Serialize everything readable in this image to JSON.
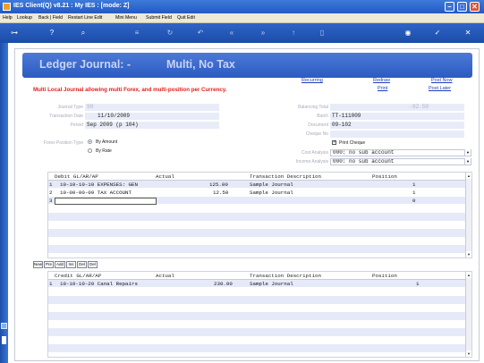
{
  "window": {
    "title": "IES Client(Q) v8.21 : My IES :      [mode: Z]",
    "minimize": "–",
    "maximize": "□",
    "close": "✕"
  },
  "menu": [
    "Help",
    "Lookup",
    "Back | Field",
    "Restart Line Edit",
    "Mini Menu",
    "Submit Field",
    "Quit Edit"
  ],
  "toolbar_icons": [
    "key-icon",
    "help-icon",
    "search-icon",
    "list-icon",
    "recycle-icon",
    "back-icon",
    "rewind-icon",
    "forward-icon",
    "up-icon",
    "save-icon",
    "globe-icon",
    "check-icon",
    "close-icon"
  ],
  "header": {
    "title": "Ledger Journal: -",
    "subtitle": "Multi, No Tax"
  },
  "links": {
    "recurring": "Recurring",
    "redraw": "Redraw",
    "print": "Print",
    "post_now": "Post Now",
    "post_later": "Post Later"
  },
  "warning": "Multi Local Journal allowing multi Forex, and multi-position per Currency.",
  "left_fields": {
    "journal_type": {
      "label": "Journal Type",
      "value": "99"
    },
    "transaction_date": {
      "label": "Transaction Date",
      "value": "11/10/2009"
    },
    "period": {
      "label": "Period",
      "value": "Sep 2009 (p 104)"
    }
  },
  "forex": {
    "label": "Forex Position Type",
    "options": [
      {
        "label": "By Amount",
        "selected": true
      },
      {
        "label": "By Rate",
        "selected": false
      }
    ]
  },
  "right_fields": {
    "balancing_total": {
      "label": "Balancing Total",
      "value": "-92.50"
    },
    "batch": {
      "label": "Batch",
      "value": "TT-111009"
    },
    "document": {
      "label": "Document",
      "value": "09-102"
    },
    "cheque_no": {
      "label": "Cheque No",
      "value": ""
    },
    "print_cheque": {
      "label": "Print Cheque",
      "checked": true
    },
    "cost_analysis": {
      "label": "Cost Analysis",
      "value": "000: no sub account"
    },
    "income_analysis": {
      "label": "Income Analysis",
      "value": "000: no sub account"
    }
  },
  "debit_grid": {
    "headers": [
      "Debit GL/AR/AP",
      "Actual",
      "Transaction Description",
      "Position"
    ],
    "rows": [
      {
        "num": "1",
        "account": "10-10-10-10 EXPENSES: GEN",
        "actual": "125.00",
        "description": "Sample Journal",
        "position": "1"
      },
      {
        "num": "2",
        "account": "10-00-00-09 TAX ACCOUNT",
        "actual": "12.50",
        "description": "Sample Journal",
        "position": "1"
      },
      {
        "num": "3",
        "account": "",
        "actual": "",
        "description": "",
        "position": "0"
      }
    ]
  },
  "row_buttons": [
    "New",
    "Pre",
    "Add",
    "Ins",
    "Del",
    "Del"
  ],
  "credit_grid": {
    "headers": [
      "Credit GL/AR/AP",
      "Actual",
      "Transaction Description",
      "Position"
    ],
    "rows": [
      {
        "num": "1",
        "account": "10-10-10-20 Canal Repairs",
        "actual": "230.00",
        "description": "Sample Journal",
        "position": "1"
      }
    ]
  },
  "colors": {
    "header_blue": "#2b5bc2",
    "warning_red": "#e02020",
    "link_blue": "#1f3bbf",
    "field_bg": "#e8ecf8"
  }
}
